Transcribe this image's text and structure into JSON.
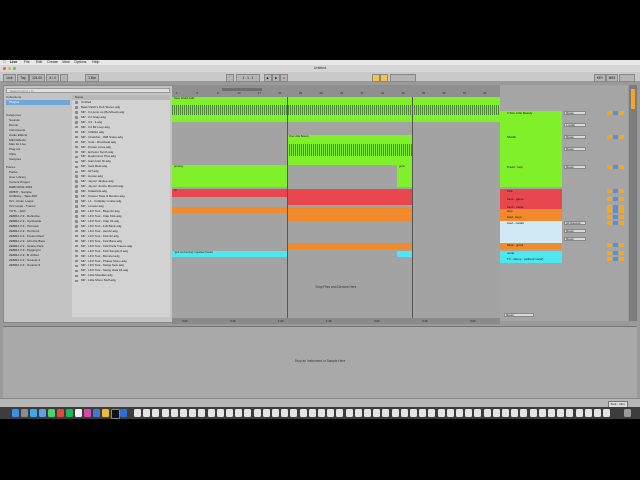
{
  "menubar": {
    "items": [
      "Live",
      "File",
      "Edit",
      "Create",
      "View",
      "Options",
      "Help"
    ]
  },
  "window": {
    "title": "Untitled"
  },
  "transport": {
    "link": "Link",
    "tap": "Tap",
    "tempo": "124.00",
    "signature": "4 / 4",
    "quantize": "1 Bar",
    "key": "KEY",
    "midi": "MIDI"
  },
  "browser": {
    "search_placeholder": "Search (Cmd + F)",
    "collections_header": "Collections",
    "collections": [
      "Plugins"
    ],
    "categories_header": "Categories",
    "categories": [
      "Sounds",
      "Drums",
      "Instruments",
      "Audio Effects",
      "MIDI Effects",
      "Max for Live",
      "Plug-ins",
      "Clips",
      "Samples"
    ],
    "places_header": "Places",
    "places": [
      "Packs",
      "User Library",
      "Current Project",
      "DEBOOCE 2019",
      "ORBIT - Sample",
      "OctBoisy - Tape 808",
      "Oct - Drum Loops",
      "Oct Loops - Trance",
      "TOTL - 10th",
      "ZEBRA 2.9 - Definitive",
      "ZEBRA 2.9 - Synthwide",
      "ZEBRA 2.9 - Tortured",
      "ZEBRA 2.9 - Horizons",
      "ZEBRA 2.9 - Frozen Reef",
      "ZEBRA 2.9 - Afro Da Bass",
      "ZEBRA 2.9 - Space Pack",
      "ZEBRA 2.9 - Digging in",
      "ZEBRA 2.9 - B 4 Mad",
      "ZEBRA 2.9 - Sounds 4",
      "ZEBRA 2.9 - Sounds 5"
    ],
    "list_header": "Name",
    "list_parent": "Untitled",
    "files": [
      "Bass Patch's Dub Stereo.adg",
      "MP - C1 jump up (Bohrbeat).adg",
      "MP - C1 Snap.adg",
      "MP - C3 - 2.adg",
      "MP - C4 Bit Loop.adg",
      "MP - C6ENA.adg",
      "MP - Chamber - 808 Snare.adg",
      "MP - Cola - Drumbeat.adg",
      "MP - Dream Lines.adg",
      "MP - Echelon Synth.adg",
      "MP - Euphonium Plus.adg",
      "MP - Gain Instr Dr.adg",
      "MP - Gels Beat.adg",
      "MP - HIT.adg",
      "MP - Hooter.adg",
      "MP - Jaynor Jankee.adg",
      "MP - Jaynor Jumbo Monolit.adg",
      "MP - Kalashnik.adg",
      "MP - Kramer Tape & Monitor.adg",
      "MP - L1 - Coldplay Limiter.adg",
      "MP - Leveler.adg",
      "MP - LFO Tool - Bass 02.adg",
      "MP - LFO Tool - Clap Kick.adg",
      "MP - LFO Tool - Clap 02.adg",
      "MP - LFO Tool - Full Bank.adg",
      "MP - LFO Tool - Hat 02.adg",
      "MP - LFO Tool - Kick 02.adg",
      "MP - LFO Tool - Kick Bass.adg",
      "MP - LFO Tool - Kick Pads Trance.adg",
      "MP - LFO Tool - Kick Sample 8.adg",
      "MP - LFO Tool - Monster.adg",
      "MP - LFO Tool - Phaser Mono.adg",
      "MP - LFO Tool - Swing Sets.adg",
      "MP - LFO Tool - Swing Hats 04.adg",
      "MP - Little Moodles.adg",
      "MP - Little Mono Stuff.adg"
    ]
  },
  "arrangement": {
    "ruler_marks": [
      "1",
      "5",
      "9",
      "13",
      "17",
      "21",
      "25",
      "29",
      "33",
      "37",
      "41",
      "45",
      "49",
      "53",
      "57",
      "61"
    ],
    "clips": [
      {
        "lane": 0,
        "label": "Naan Waddi Falls"
      },
      {
        "lane": 1,
        "label": "One Little Beauty"
      },
      {
        "lane": 2,
        "label": "growing"
      },
      {
        "lane": 2,
        "label": "grow"
      },
      {
        "lane": 3,
        "label": "hit"
      },
      {
        "lane": 7,
        "label": "\"gott me burning\" rejected (Vocal)"
      }
    ],
    "drop_text": "Drop Files and Devices Here",
    "overview_times": [
      "0:00",
      "0:30",
      "1:00",
      "1:30",
      "2:00",
      "2:30",
      "3:00"
    ]
  },
  "tracks": [
    {
      "name": "3 Two Little Beauty",
      "color": "#7ff02a"
    },
    {
      "name": "Sheikh",
      "color": "#7ff02a"
    },
    {
      "name": "8 add - loop",
      "color": "#7ff02a"
    },
    {
      "name": "Kick",
      "color": "#e8474e"
    },
    {
      "name": "bass - game",
      "color": "#e8474e"
    },
    {
      "name": "bass - metal",
      "color": "#e8474e"
    },
    {
      "name": "clap",
      "color": "#f08a2b"
    },
    {
      "name": "lead - keys",
      "color": "#f08a2b"
    },
    {
      "name": "load - vocals",
      "color": "#cfe9f5"
    },
    {
      "name": "bass - growl",
      "color": "#f08a2b"
    },
    {
      "name": "vocal",
      "color": "#4fe7ef"
    },
    {
      "name": "TV - Remy - (without vocal)",
      "color": "#4fe7ef"
    }
  ],
  "mixer": {
    "io_labels": [
      "Master",
      "1-Audio",
      "Master",
      "Master",
      "Master",
      "All Channels",
      "Master",
      "Master"
    ],
    "master_label": "Master"
  },
  "detail": {
    "drop_text": "Drop an Instrument or Sample Here"
  },
  "status": {
    "right_label": "Kick - Intro"
  },
  "colors": {
    "green": "#7ff02a",
    "red": "#e8474e",
    "orange": "#f08a2b",
    "cyan": "#4fe7ef",
    "lightblue": "#cfe9f5",
    "yellow": "#f5c542"
  }
}
